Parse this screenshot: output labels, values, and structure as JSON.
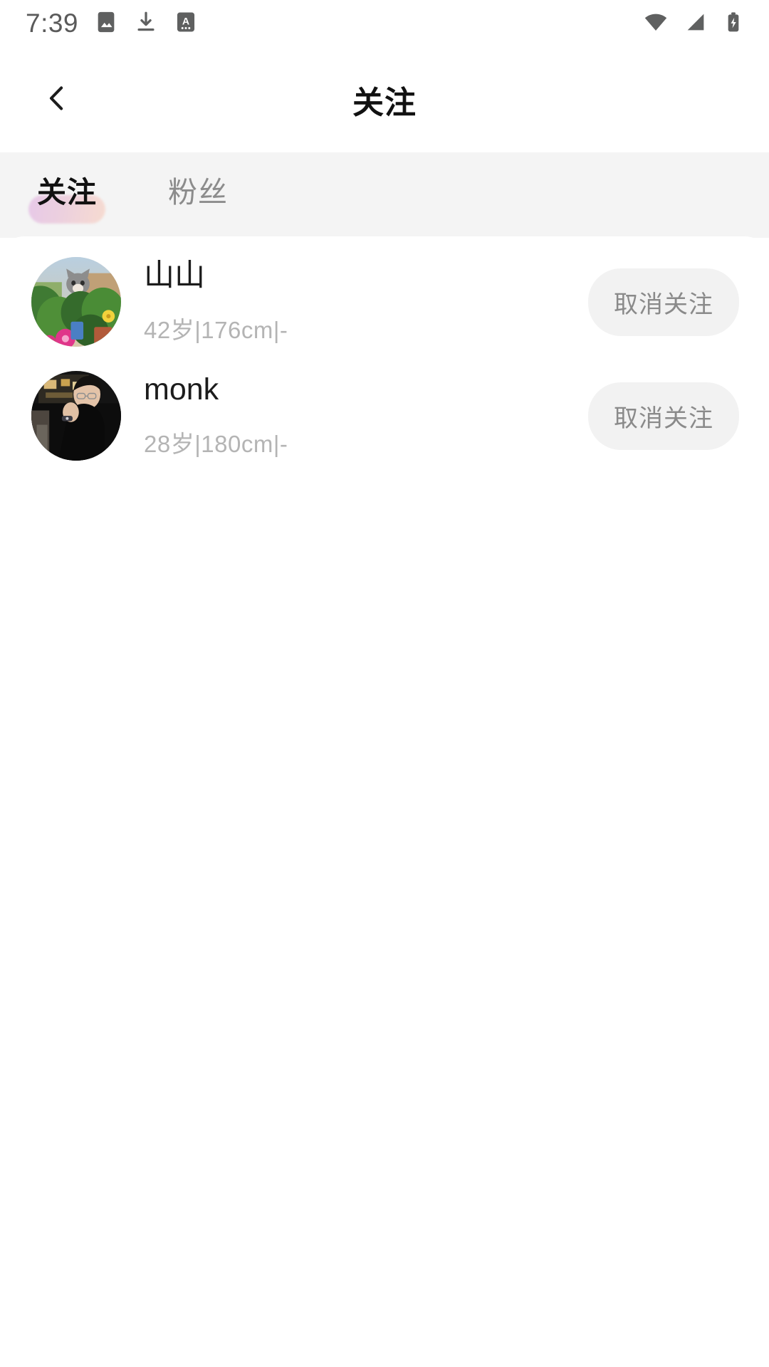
{
  "status_bar": {
    "time": "7:39",
    "left_icons": [
      "image-icon",
      "download-icon",
      "translate-icon"
    ],
    "right_icons": [
      "wifi-icon",
      "cellular-signal-icon",
      "battery-charging-icon"
    ],
    "icon_color": "#5f6060"
  },
  "header": {
    "back_icon": "chevron-left-icon",
    "title": "关注"
  },
  "tabs": {
    "items": [
      {
        "label": "关注",
        "active": true
      },
      {
        "label": "粉丝",
        "active": false
      }
    ],
    "indicator_gradient_from": "#e7c6e8",
    "indicator_gradient_to": "#f7dacf",
    "strip_background": "#f4f4f4"
  },
  "list": {
    "rows": [
      {
        "name": "山山",
        "meta": "42岁|176cm|-",
        "action_label": "取消关注",
        "avatar_name": "avatar-shanshan",
        "avatar_desc": "cat-among-potted-plants"
      },
      {
        "name": "monk",
        "meta": "28岁|180cm|-",
        "action_label": "取消关注",
        "avatar_name": "avatar-monk",
        "avatar_desc": "person-with-glasses-in-car-dark"
      }
    ]
  },
  "colors": {
    "page_background": "#ffffff",
    "card_background": "#ffffff",
    "name_text": "#1c1c1c",
    "meta_text": "#b4b4b4",
    "button_background": "#f2f2f2",
    "button_text": "#8a8a8a",
    "tab_active_text": "#111111",
    "tab_inactive_text": "#8c8c8c"
  }
}
